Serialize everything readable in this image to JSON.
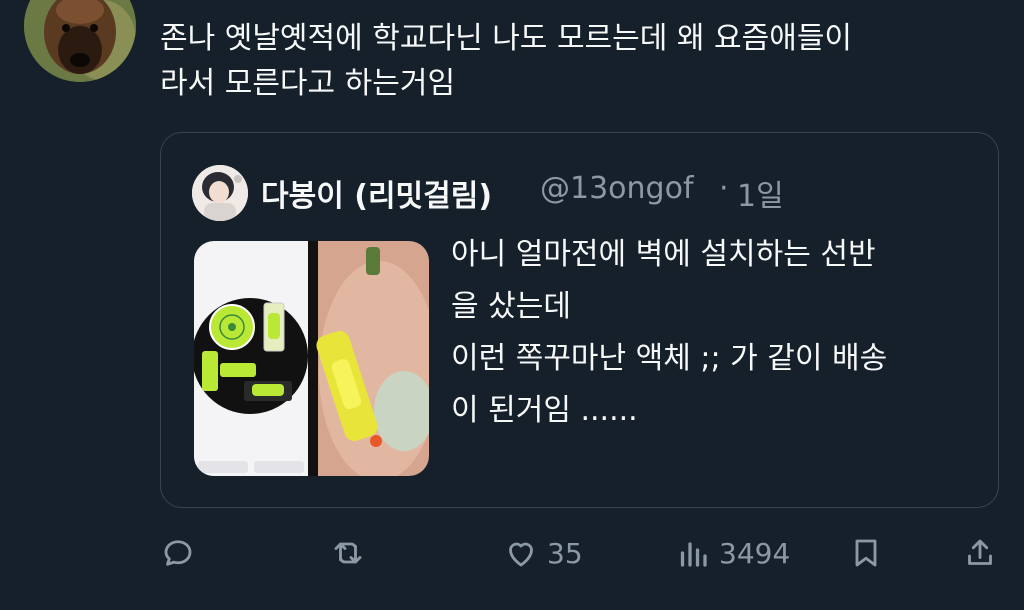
{
  "tweet": {
    "author_name": "",
    "text_lines": [
      "존나 옛날옛적에 학교다닌 나도 모르는데 왜 요즘애들이",
      "라서 모른다고 하는거임"
    ]
  },
  "quote": {
    "display_name": "다봉이 (리밋걸림)",
    "handle": "@13ongof",
    "separator": "·",
    "time": "1일",
    "text_lines": [
      "아니 얼마전에 벽에 설치하는 선반",
      "을 샀는데",
      "이런 쪽꾸마난 액체 ;; 가 같이 배송",
      "이 된거임 ......"
    ]
  },
  "actions": {
    "reply_count": "",
    "retweet_count": "",
    "like_count": "35",
    "view_count": "3494"
  },
  "icons": {
    "reply": "reply-icon",
    "retweet": "retweet-icon",
    "like": "heart-icon",
    "views": "views-chart-icon",
    "bookmark": "bookmark-icon",
    "share": "share-icon"
  },
  "colors": {
    "background": "#15202b",
    "text_primary": "#f7f9f9",
    "text_secondary": "#8b98a5",
    "border": "#38444d",
    "bubble_level_green": "#b9e835"
  }
}
